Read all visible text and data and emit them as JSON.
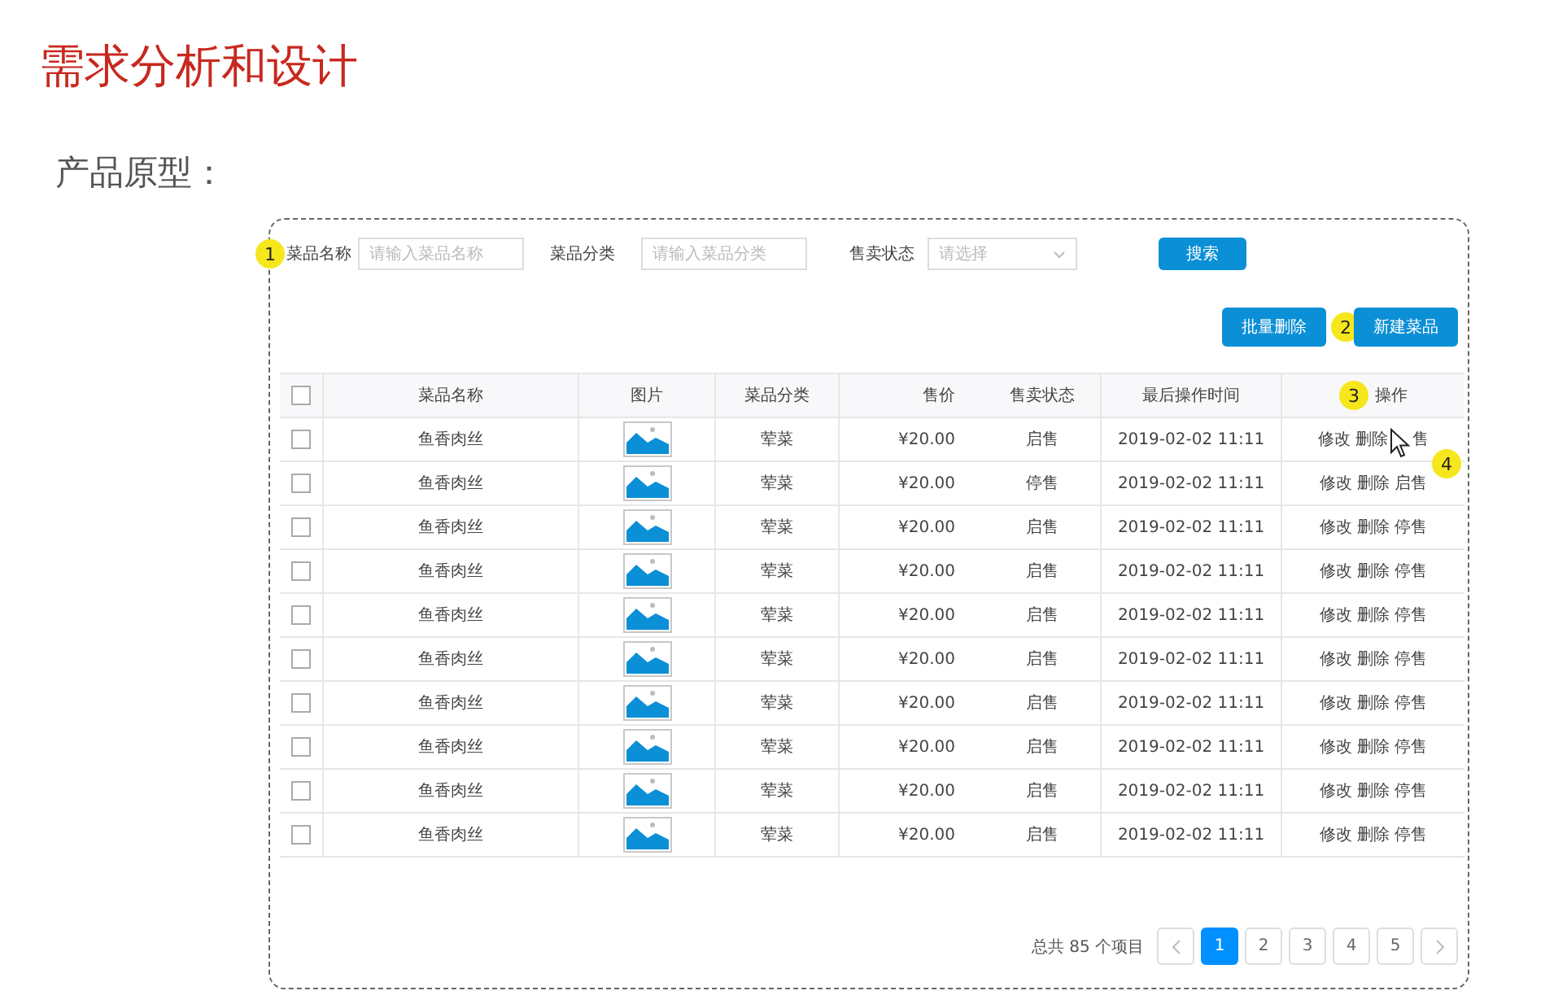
{
  "slide": {
    "title": "需求分析和设计",
    "subtitle": "产品原型："
  },
  "filters": [
    {
      "kind": "text",
      "label": "菜品名称",
      "placeholder": "请输入菜品名称",
      "annotation": "1"
    },
    {
      "kind": "text",
      "label": "菜品分类",
      "placeholder": "请输入菜品分类"
    },
    {
      "kind": "select",
      "label": "售卖状态",
      "placeholder": "请选择"
    }
  ],
  "search_button": "搜索",
  "toolbar_buttons": [
    {
      "label": "批量删除"
    },
    {
      "label": "新建菜品",
      "annotation": "2"
    }
  ],
  "table": {
    "columns": [
      {
        "kind": "check",
        "checked": false
      },
      {
        "kind": "text",
        "label": "菜品名称"
      },
      {
        "kind": "text",
        "label": "图片"
      },
      {
        "kind": "text",
        "label": "菜品分类"
      },
      {
        "kind": "right",
        "label": "售价"
      },
      {
        "kind": "text",
        "label": "售卖状态"
      },
      {
        "kind": "text",
        "label": "最后操作时间"
      },
      {
        "kind": "text",
        "label": "操作",
        "annotation": "3"
      }
    ],
    "rows": [
      {
        "checked": false,
        "name": "鱼香肉丝",
        "category": "荤菜",
        "price": "¥20.00",
        "status": "启售",
        "updated": "2019-02-02 11:11",
        "actions": [
          "修改",
          "删除",
          "售"
        ],
        "pointer_over": true
      },
      {
        "checked": false,
        "name": "鱼香肉丝",
        "category": "荤菜",
        "price": "¥20.00",
        "status": "停售",
        "updated": "2019-02-02 11:11",
        "actions": [
          "修改",
          "删除",
          "启售"
        ],
        "annotation": "4"
      },
      {
        "checked": false,
        "name": "鱼香肉丝",
        "category": "荤菜",
        "price": "¥20.00",
        "status": "启售",
        "updated": "2019-02-02 11:11",
        "actions": [
          "修改",
          "删除",
          "停售"
        ]
      },
      {
        "checked": false,
        "name": "鱼香肉丝",
        "category": "荤菜",
        "price": "¥20.00",
        "status": "启售",
        "updated": "2019-02-02 11:11",
        "actions": [
          "修改",
          "删除",
          "停售"
        ]
      },
      {
        "checked": false,
        "name": "鱼香肉丝",
        "category": "荤菜",
        "price": "¥20.00",
        "status": "启售",
        "updated": "2019-02-02 11:11",
        "actions": [
          "修改",
          "删除",
          "停售"
        ]
      },
      {
        "checked": false,
        "name": "鱼香肉丝",
        "category": "荤菜",
        "price": "¥20.00",
        "status": "启售",
        "updated": "2019-02-02 11:11",
        "actions": [
          "修改",
          "删除",
          "停售"
        ]
      },
      {
        "checked": false,
        "name": "鱼香肉丝",
        "category": "荤菜",
        "price": "¥20.00",
        "status": "启售",
        "updated": "2019-02-02 11:11",
        "actions": [
          "修改",
          "删除",
          "停售"
        ]
      },
      {
        "checked": false,
        "name": "鱼香肉丝",
        "category": "荤菜",
        "price": "¥20.00",
        "status": "启售",
        "updated": "2019-02-02 11:11",
        "actions": [
          "修改",
          "删除",
          "停售"
        ]
      },
      {
        "checked": false,
        "name": "鱼香肉丝",
        "category": "荤菜",
        "price": "¥20.00",
        "status": "启售",
        "updated": "2019-02-02 11:11",
        "actions": [
          "修改",
          "删除",
          "停售"
        ]
      },
      {
        "checked": false,
        "name": "鱼香肉丝",
        "category": "荤菜",
        "price": "¥20.00",
        "status": "启售",
        "updated": "2019-02-02 11:11",
        "actions": [
          "修改",
          "删除",
          "停售"
        ]
      }
    ]
  },
  "pagination": {
    "total": "总共 85 个项目",
    "pages": [
      {
        "label": "1",
        "selected": true
      },
      {
        "label": "2",
        "selected": false
      },
      {
        "label": "3",
        "selected": false
      },
      {
        "label": "4",
        "selected": false
      },
      {
        "label": "5",
        "selected": false
      }
    ]
  }
}
